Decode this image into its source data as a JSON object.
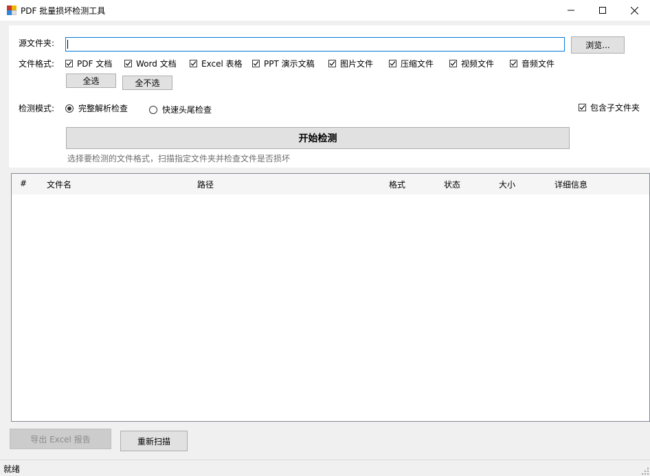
{
  "window": {
    "title": "PDF 批量损坏检测工具"
  },
  "source": {
    "label": "源文件夹:",
    "value": "",
    "browse_label": "浏览..."
  },
  "formats": {
    "label": "文件格式:",
    "items": [
      {
        "label": "PDF 文档",
        "checked": true
      },
      {
        "label": "Word 文档",
        "checked": true
      },
      {
        "label": "Excel 表格",
        "checked": true
      },
      {
        "label": "PPT 演示文稿",
        "checked": true
      },
      {
        "label": "图片文件",
        "checked": true
      },
      {
        "label": "压缩文件",
        "checked": true
      },
      {
        "label": "视频文件",
        "checked": true
      },
      {
        "label": "音频文件",
        "checked": true
      }
    ],
    "select_all_label": "全选",
    "select_none_label": "全不选"
  },
  "mode": {
    "label": "检测模式:",
    "options": [
      {
        "label": "完整解析检查",
        "selected": true
      },
      {
        "label": "快速头尾检查",
        "selected": false
      }
    ],
    "include_subfolders_label": "包含子文件夹",
    "include_subfolders": true
  },
  "start_label": "开始检测",
  "hint": "选择要检测的文件格式，扫描指定文件夹并检查文件是否损坏",
  "results": {
    "columns": [
      "#",
      "文件名",
      "路径",
      "格式",
      "状态",
      "大小",
      "详细信息"
    ],
    "rows": []
  },
  "export_label": "导出 Excel 报告",
  "rescan_label": "重新扫描",
  "status": "就绪"
}
